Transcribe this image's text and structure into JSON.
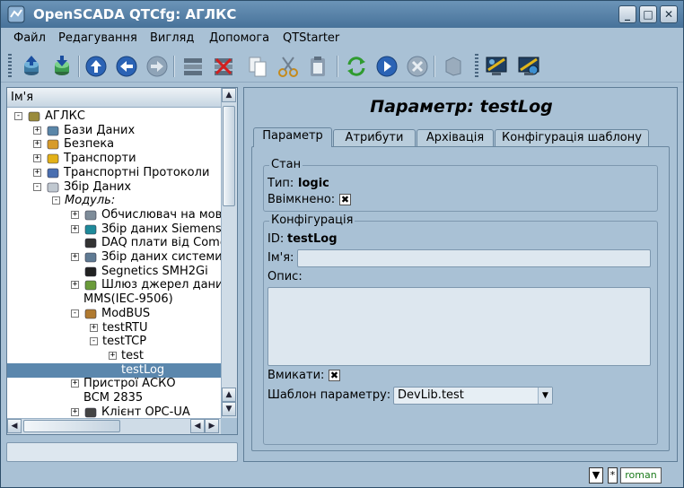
{
  "window": {
    "title": "OpenSCADA QTCfg: АГЛКС"
  },
  "window_buttons": {
    "minimize": "_",
    "maximize": "□",
    "close": "✕"
  },
  "menu": {
    "items": [
      "Файл",
      "Редагування",
      "Вигляд",
      "Допомога",
      "QTStarter"
    ]
  },
  "toolbar": {
    "icons": [
      "db-load-icon",
      "db-save-icon",
      "up-icon",
      "back-icon",
      "forward-icon",
      "add-item-icon",
      "delete-item-icon",
      "copy-icon",
      "cut-icon",
      "paste-icon",
      "refresh-icon",
      "start-icon",
      "stop-icon",
      "help-icon",
      "station-icon",
      "station-config-icon"
    ]
  },
  "tree": {
    "header": "Ім'я",
    "items": [
      {
        "label": "АГЛКС",
        "level": 0,
        "exp": "-",
        "icon": "station"
      },
      {
        "label": "Бази Даних",
        "level": 1,
        "exp": "+",
        "icon": "db"
      },
      {
        "label": "Безпека",
        "level": 1,
        "exp": "+",
        "icon": "users"
      },
      {
        "label": "Транспорти",
        "level": 1,
        "exp": "+",
        "icon": "bolt"
      },
      {
        "label": "Транспортні Протоколи",
        "level": 1,
        "exp": "+",
        "icon": "proto"
      },
      {
        "label": "Збір Даних",
        "level": 1,
        "exp": "-",
        "icon": "chart"
      },
      {
        "label": "Модуль:",
        "level": 2,
        "exp": "-",
        "icon": "",
        "italic": true
      },
      {
        "label": "Обчислювач на мові",
        "level": 3,
        "exp": "+",
        "icon": "calc"
      },
      {
        "label": "Збір даних Siemens",
        "level": 3,
        "exp": "+",
        "icon": "siemens"
      },
      {
        "label": "DAQ плати від Comedi",
        "level": 3,
        "exp": "",
        "icon": "penguin"
      },
      {
        "label": "Збір даних системи",
        "level": 3,
        "exp": "+",
        "icon": "system"
      },
      {
        "label": "Segnetics SMH2Gi",
        "level": 3,
        "exp": "",
        "icon": "device"
      },
      {
        "label": "Шлюз джерел даних",
        "level": 3,
        "exp": "+",
        "icon": "gateway"
      },
      {
        "label": "MMS(IEC-9506)",
        "level": 3,
        "exp": "",
        "icon": ""
      },
      {
        "label": "ModBUS",
        "level": 3,
        "exp": "-",
        "icon": "modbus"
      },
      {
        "label": "testRTU",
        "level": 4,
        "exp": "+",
        "icon": ""
      },
      {
        "label": "testTCP",
        "level": 4,
        "exp": "-",
        "icon": ""
      },
      {
        "label": "test",
        "level": 5,
        "exp": "+",
        "icon": ""
      },
      {
        "label": "testLog",
        "level": 5,
        "exp": "",
        "icon": "",
        "selected": true
      },
      {
        "label": "Пристрої АСКО",
        "level": 3,
        "exp": "+",
        "icon": ""
      },
      {
        "label": "BCM 2835",
        "level": 3,
        "exp": "",
        "icon": ""
      },
      {
        "label": "Клієнт OPC-UA",
        "level": 3,
        "exp": "+",
        "icon": "opc"
      }
    ]
  },
  "page": {
    "title": "Параметр: testLog",
    "tabs": [
      "Параметр",
      "Атрибути",
      "Архівація",
      "Конфігурація шаблону"
    ],
    "state_group": {
      "title": "Стан",
      "type_label": "Тип:",
      "type_value": "logic",
      "enabled_label": "Ввімкнено:",
      "enabled_mark": "✖"
    },
    "config_group": {
      "title": "Конфігурація",
      "id_label": "ID:",
      "id_value": "testLog",
      "name_label": "Ім'я:",
      "name_value": "",
      "descr_label": "Опис:",
      "descr_value": "",
      "to_enable_label": "Вмикати:",
      "to_enable_mark": "✖",
      "template_label": "Шаблон параметру:",
      "template_value": "DevLib.test"
    }
  },
  "status": {
    "mode_mark": "*",
    "user": "roman"
  },
  "colors": {
    "window_bg": "#a9c1d5",
    "titlebar": "#47729a",
    "selection": "#5b87ad",
    "user_text": "#1a7a1a"
  }
}
